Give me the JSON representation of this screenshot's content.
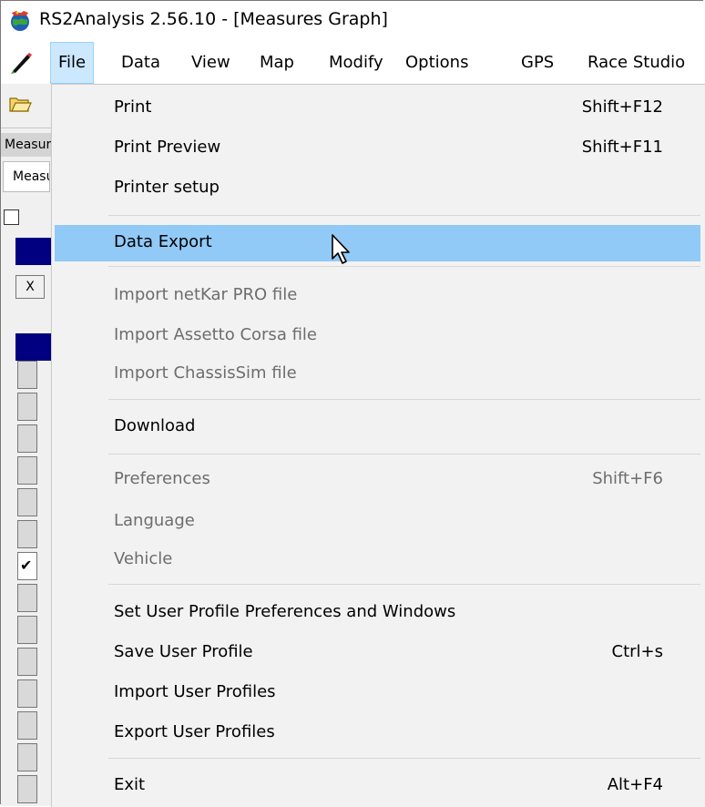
{
  "window": {
    "title": "RS2Analysis 2.56.10 - [Measures Graph]"
  },
  "menubar": {
    "items": [
      "File",
      "Data",
      "View",
      "Map",
      "Modify",
      "Options",
      "GPS",
      "Race Studio"
    ],
    "active": "File"
  },
  "left_panel": {
    "header": "Measures",
    "tab": "Measures",
    "x_button": "X"
  },
  "file_menu": {
    "groups": [
      [
        {
          "label": "Print",
          "shortcut": "Shift+F12",
          "enabled": true
        },
        {
          "label": "Print Preview",
          "shortcut": "Shift+F11",
          "enabled": true
        },
        {
          "label": "Printer setup",
          "shortcut": "",
          "enabled": true
        }
      ],
      [
        {
          "label": "Data Export",
          "shortcut": "",
          "enabled": true,
          "highlighted": true
        }
      ],
      [
        {
          "label": "Import netKar PRO file",
          "shortcut": "",
          "enabled": false
        },
        {
          "label": "Import Assetto Corsa file",
          "shortcut": "",
          "enabled": false
        },
        {
          "label": "Import ChassisSim file",
          "shortcut": "",
          "enabled": false
        }
      ],
      [
        {
          "label": "Download",
          "shortcut": "",
          "enabled": true
        }
      ],
      [
        {
          "label": "Preferences",
          "shortcut": "Shift+F6",
          "enabled": false
        },
        {
          "label": "Language",
          "shortcut": "",
          "enabled": false
        },
        {
          "label": "Vehicle",
          "shortcut": "",
          "enabled": false
        }
      ],
      [
        {
          "label": "Set User Profile Preferences and Windows",
          "shortcut": "",
          "enabled": true
        },
        {
          "label": "Save User Profile",
          "shortcut": "Ctrl+s",
          "enabled": true
        },
        {
          "label": "Import User Profiles",
          "shortcut": "",
          "enabled": true
        },
        {
          "label": "Export User Profiles",
          "shortcut": "",
          "enabled": true
        }
      ],
      [
        {
          "label": "Exit",
          "shortcut": "Alt+F4",
          "enabled": true
        }
      ]
    ]
  },
  "colors": {
    "highlight": "#91c9f7",
    "menu_bg": "#f2f2f2",
    "active_menu": "#cce8ff",
    "disabled_text": "#6d6d6d",
    "navy": "#000080"
  },
  "icons": {
    "app": "globe-app-icon",
    "menu": "pen-icon",
    "toolbar": "open-folder-icon",
    "cursor": "mouse-pointer-icon"
  }
}
